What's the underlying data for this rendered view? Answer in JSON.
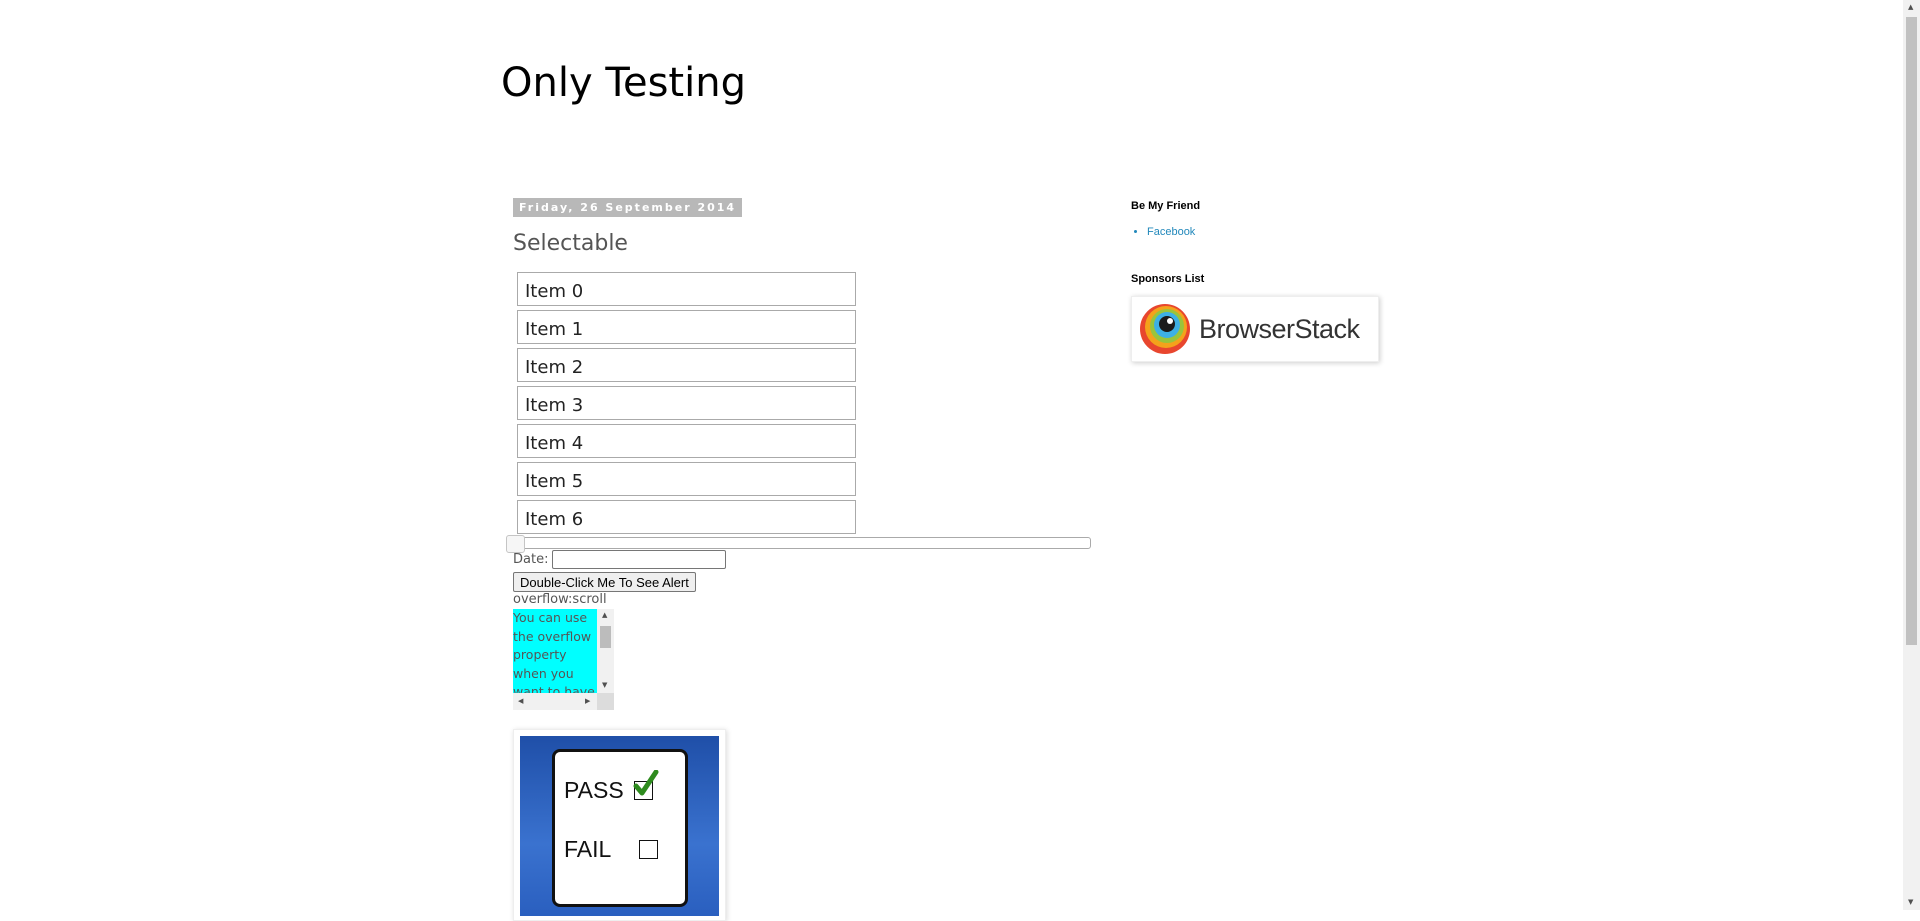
{
  "header": {
    "title": "Only Testing"
  },
  "post": {
    "date": "Friday, 26 September 2014",
    "title": "Selectable",
    "selectable_items": [
      "Item 0",
      "Item 1",
      "Item 2",
      "Item 3",
      "Item 4",
      "Item 5",
      "Item 6"
    ],
    "slider": {
      "value": 0
    },
    "date_label": "Date:",
    "date_value": "",
    "double_click_button": "Double-Click Me To See Alert",
    "overflow_label": "overflow:scroll",
    "overflow_text": "You can use the overflow property when you want to have",
    "image": {
      "pass_label": "PASS",
      "fail_label": "FAIL"
    }
  },
  "sidebar": {
    "friend_heading": "Be My Friend",
    "friend_links": [
      "Facebook"
    ],
    "sponsors_heading": "Sponsors List",
    "sponsor_name": "BrowserStack"
  },
  "colors": {
    "overflow_bg": "#00ffff",
    "link": "#2288bb",
    "date_header_bg": "#b8b8b8"
  }
}
